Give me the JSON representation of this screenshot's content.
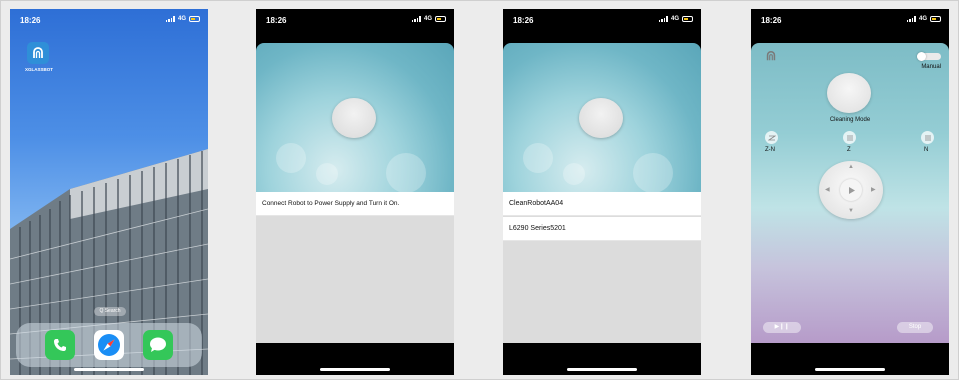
{
  "status": {
    "time": "18:26",
    "network": "4G"
  },
  "screen1": {
    "app_label": "XGLASSBOT",
    "search_label": "Q Search",
    "dock": [
      "phone-icon",
      "safari-icon",
      "messages-icon"
    ]
  },
  "screen2": {
    "instruction": "Connect Robot to Power Supply and Turn it On."
  },
  "screen3": {
    "devices": [
      "CleanRobotAA04",
      "L6290 Series5201"
    ]
  },
  "screen4": {
    "manual_label": "Manual",
    "mode_title": "Cleaning Mode",
    "modes": [
      "Z-N",
      "Z",
      "N"
    ],
    "play_pause_label": "▶❙❙",
    "stop_label": "Stop"
  },
  "colors": {
    "accent": "#2f8fd8",
    "green": "#34c759"
  }
}
